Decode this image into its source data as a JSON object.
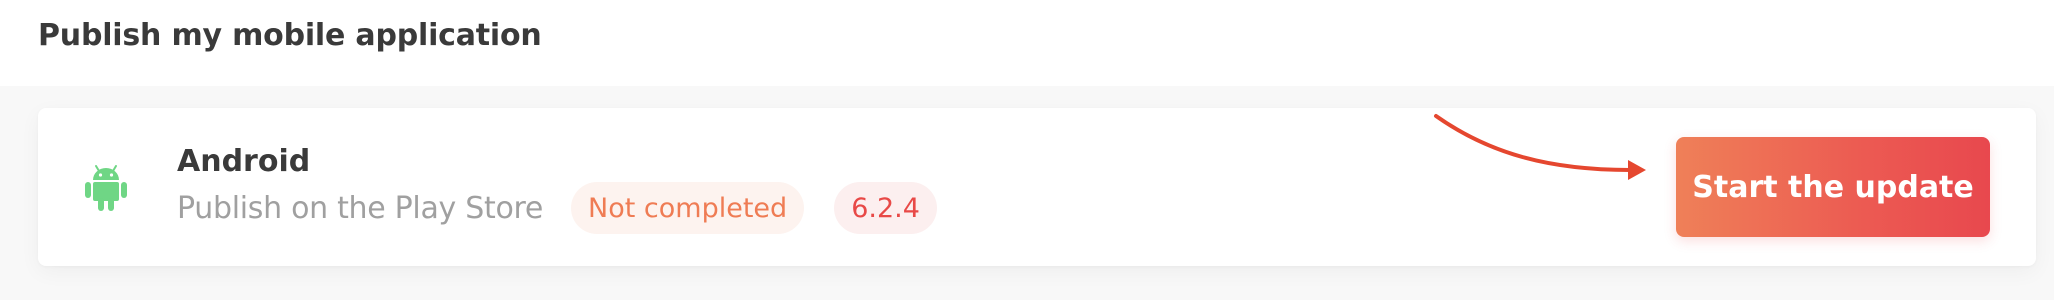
{
  "page": {
    "title": "Publish my mobile application"
  },
  "platform": {
    "icon": "android-icon",
    "name": "Android",
    "store_text": "Publish on the Play Store",
    "status_label": "Not completed",
    "version_label": "6.2.4"
  },
  "actions": {
    "start_update_label": "Start the update"
  },
  "colors": {
    "title": "#3a3a3a",
    "android_green": "#6fd685",
    "status_text": "#ef7c54",
    "status_bg": "#fdf3ef",
    "version_text": "#e84947",
    "version_bg": "#fcefef",
    "arrow": "#e5472f",
    "button_gradient_start": "#ef8058",
    "button_gradient_end": "#e8484e"
  }
}
